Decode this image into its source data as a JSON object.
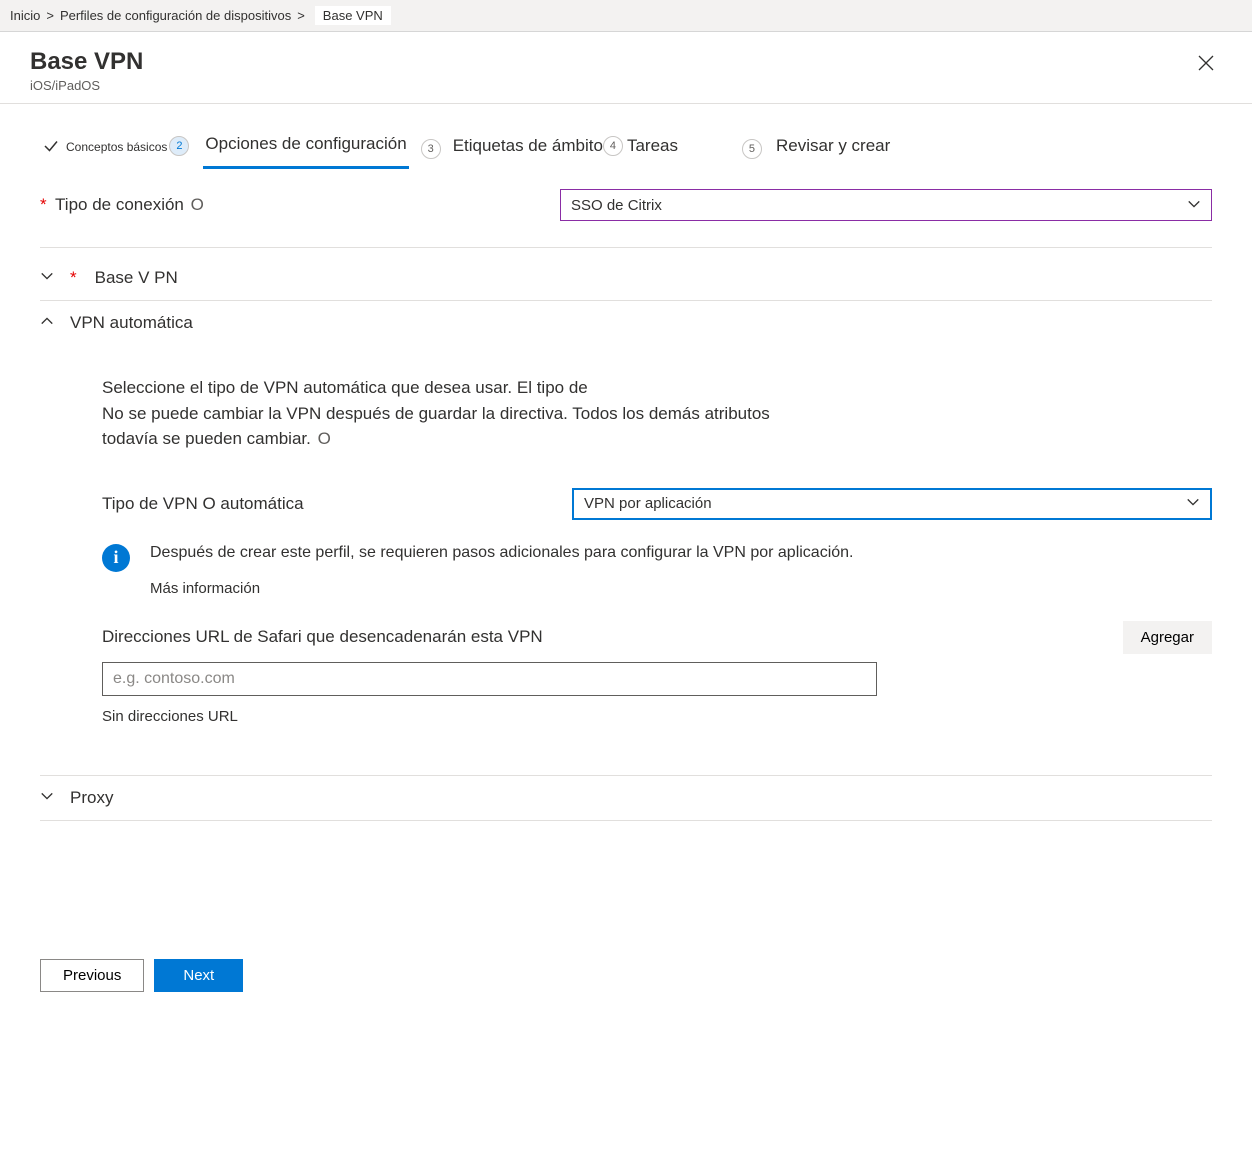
{
  "breadcrumb": {
    "home": "Inicio",
    "sep": ">",
    "profiles": "Perfiles de configuración de dispositivos",
    "current": "Base VPN"
  },
  "header": {
    "title": "Base VPN",
    "subtitle": "iOS/iPadOS"
  },
  "tabs": {
    "basics": "Conceptos básicos",
    "basics_num": "2",
    "config": "Opciones de configuración",
    "scope_num": "3",
    "scope": "Etiquetas de ámbito",
    "tasks_num": "4",
    "tasks": "Tareas",
    "review_num": "5",
    "review": "Revisar y crear"
  },
  "fields": {
    "connection_type_label": "Tipo de conexión",
    "connection_type_value": "SSO de Citrix",
    "base_vpn_label": "Base V PN",
    "auto_vpn_label": "VPN automática",
    "auto_desc_1": "Seleccione el tipo de VPN automática que desea usar. El tipo de",
    "auto_desc_2": "No se puede cambiar la VPN después de guardar la directiva. Todos los demás atributos",
    "auto_desc_3": "todavía se pueden cambiar.",
    "auto_type_label": "Tipo de VPN O automática",
    "auto_type_value": "VPN por aplicación",
    "info_text": "Después de crear este perfil, se requieren pasos adicionales para configurar la VPN por aplicación.",
    "info_link": "Más información",
    "safari_url_label": "Direcciones URL de Safari que desencadenarán esta VPN",
    "add_btn": "Agregar",
    "url_placeholder": "e.g. contoso.com",
    "no_urls": "Sin direcciones URL",
    "proxy_label": "Proxy"
  },
  "footer": {
    "previous": "Previous",
    "next": "Next"
  },
  "info_glyph": "O"
}
